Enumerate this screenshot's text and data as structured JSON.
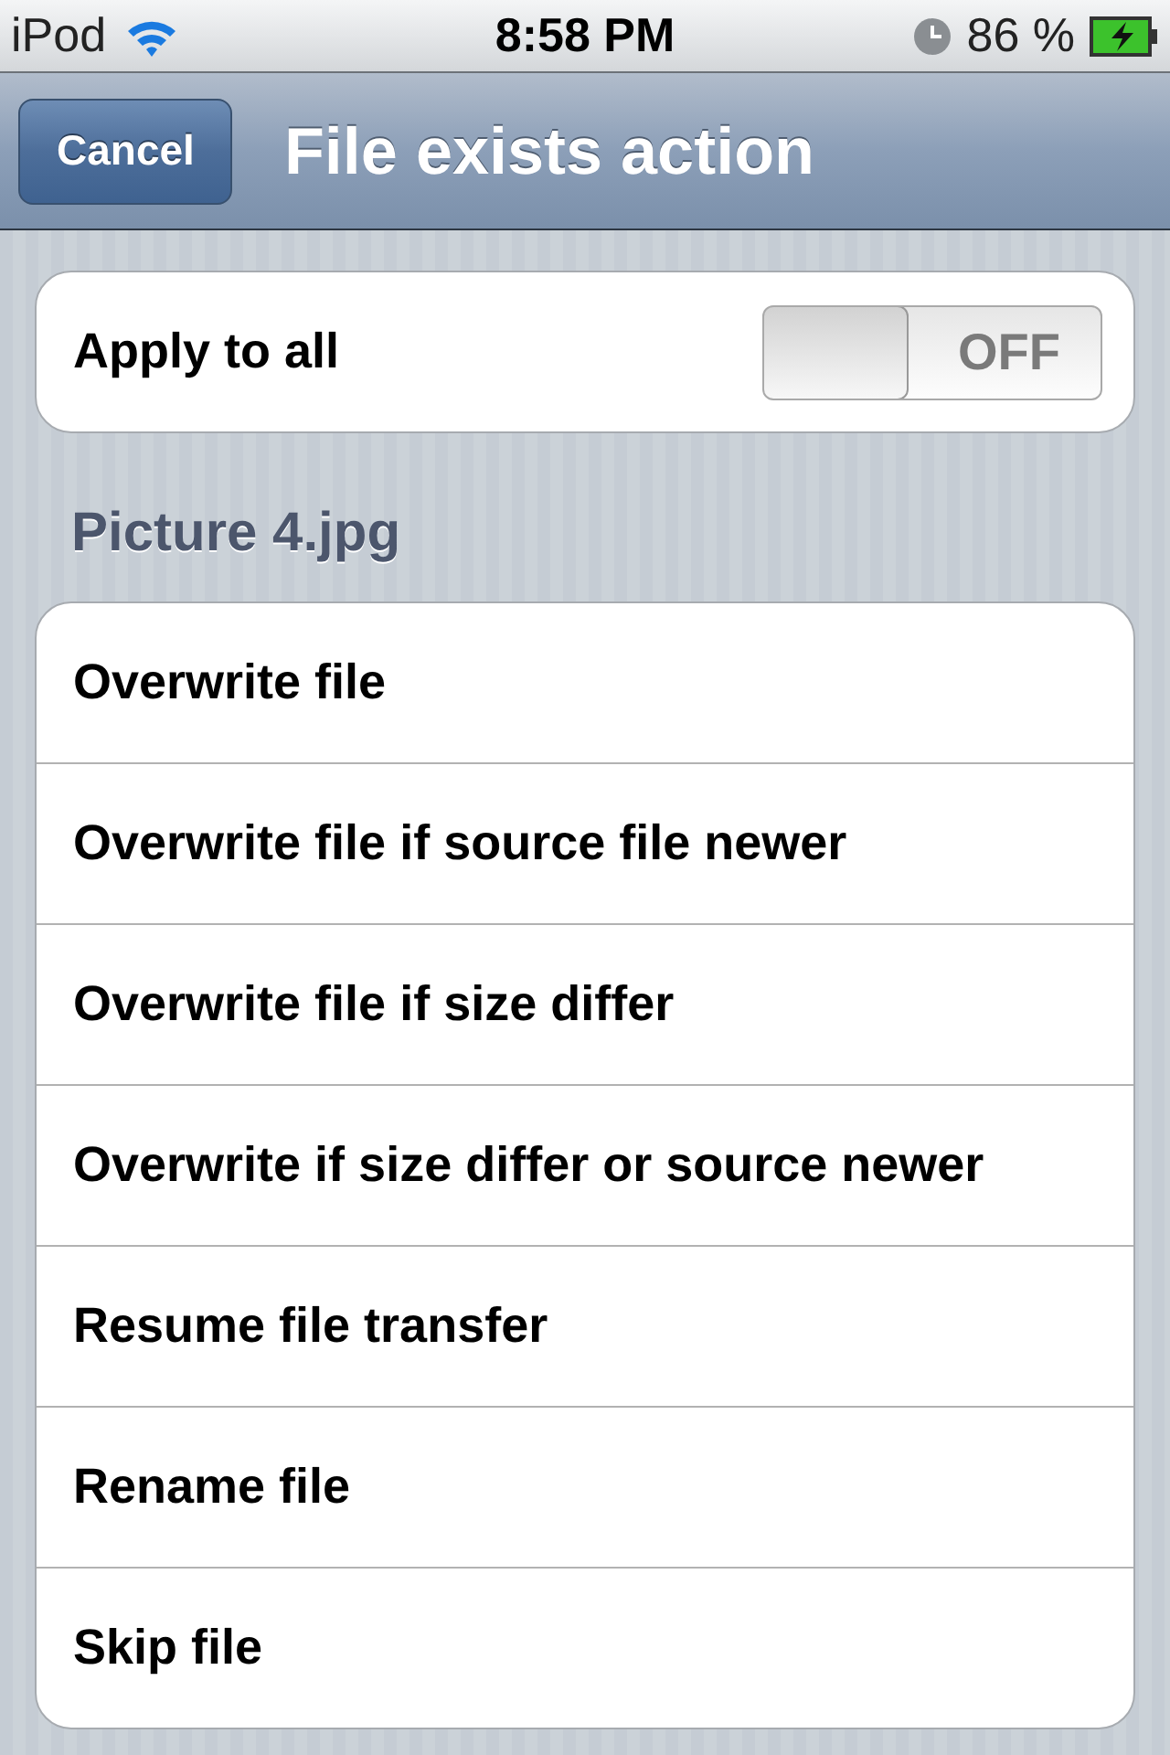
{
  "status_bar": {
    "carrier": "iPod",
    "time": "8:58 PM",
    "battery": "86 %"
  },
  "nav_bar": {
    "cancel_button": "Cancel",
    "title": "File exists action"
  },
  "apply_to_all": {
    "label": "Apply to all",
    "on": false,
    "switch_label": "OFF"
  },
  "section_header": "Picture 4.jpg",
  "actions": [
    {
      "label": "Overwrite file"
    },
    {
      "label": "Overwrite file if source file newer"
    },
    {
      "label": "Overwrite file if size differ"
    },
    {
      "label": "Overwrite if size differ or source newer"
    },
    {
      "label": "Resume file transfer"
    },
    {
      "label": "Rename file"
    },
    {
      "label": "Skip file"
    }
  ]
}
